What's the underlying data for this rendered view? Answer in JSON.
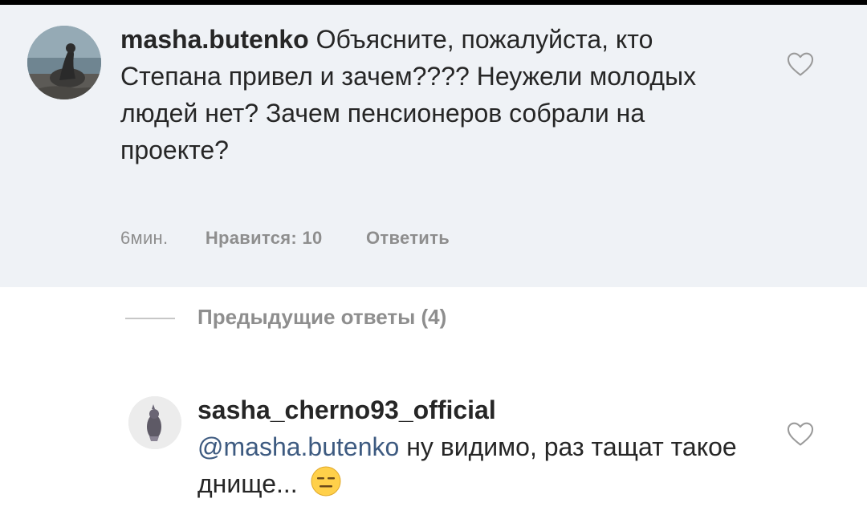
{
  "comments": [
    {
      "username": "masha.butenko",
      "text": "Объясните, пожалуйста, кто Степана привел и зачем???? Неужели молодых людей нет? Зачем пенсионеров собрали на проекте?",
      "time": "6мин.",
      "likes": "Нравится: 10",
      "reply": "Ответить"
    },
    {
      "username": "sasha_cherno93_official",
      "mention": "@masha.butenko",
      "text": "ну видимо, раз тащат такое днище...",
      "emoji": "expressionless-face"
    }
  ],
  "previous_replies": "Предыдущие ответы (4)",
  "colors": {
    "highlight": "#eff2f6",
    "mention": "#3d5a80",
    "meta": "#8e8e8e"
  },
  "icons": [
    "heart-outline-icon",
    "expressionless-face-emoji"
  ]
}
